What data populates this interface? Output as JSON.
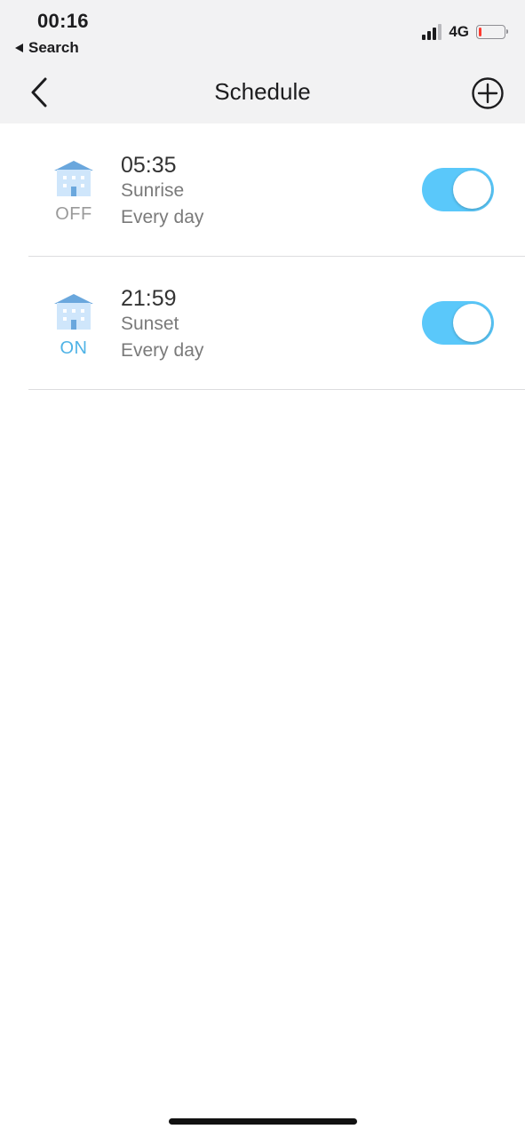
{
  "status_bar": {
    "time": "00:16",
    "back_app": "Search",
    "network": "4G",
    "battery_level": 0.12,
    "battery_color": "#ff3b30"
  },
  "nav": {
    "back_icon": "chevron-left-icon",
    "title": "Schedule",
    "add_icon": "plus-circle-icon"
  },
  "schedules": [
    {
      "state": "OFF",
      "state_color": "#9a9a9a",
      "time": "05:35",
      "event": "Sunrise",
      "repeat": "Every day",
      "enabled": true
    },
    {
      "state": "ON",
      "state_color": "#4fb3e6",
      "time": "21:59",
      "event": "Sunset",
      "repeat": "Every day",
      "enabled": true
    }
  ],
  "colors": {
    "toggle_on": "#5ac8fa",
    "header_bg": "#f2f2f3"
  }
}
